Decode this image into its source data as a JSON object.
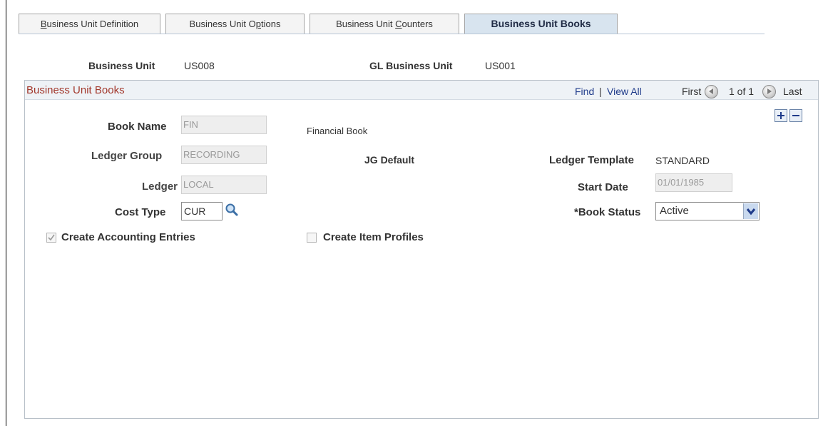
{
  "tabs": [
    {
      "pre": "",
      "acc": "B",
      "post": "usiness Unit Definition"
    },
    {
      "pre": "Business Unit O",
      "acc": "p",
      "post": "tions"
    },
    {
      "pre": "Business Unit ",
      "acc": "C",
      "post": "ounters"
    },
    {
      "pre": "Business Unit Books",
      "acc": "",
      "post": ""
    }
  ],
  "header": {
    "bu_label": "Business Unit",
    "bu_value": "US008",
    "gl_label": "GL Business Unit",
    "gl_value": "US001"
  },
  "box": {
    "title": "Business Unit Books",
    "find": "Find",
    "sep": "|",
    "view_all": "View All",
    "first": "First",
    "count": "1 of 1",
    "last": "Last"
  },
  "form": {
    "book_name_label": "Book Name",
    "book_name_value": "FIN",
    "book_name_desc": "Financial Book",
    "ledger_group_label": "Ledger Group",
    "ledger_group_value": "RECORDING",
    "jg_default": "JG Default",
    "ledger_template_label": "Ledger Template",
    "ledger_template_value": "STANDARD",
    "ledger_label": "Ledger",
    "ledger_value": "LOCAL",
    "start_date_label": "Start Date",
    "start_date_value": "01/01/1985",
    "cost_type_label": "Cost Type",
    "cost_type_value": "CUR",
    "book_status_label": "*Book Status",
    "book_status_value": "Active",
    "create_accounting_label": "Create Accounting Entries",
    "create_accounting_checked": true,
    "create_item_label": "Create Item Profiles",
    "create_item_checked": false
  },
  "icons": {
    "lookup": "magnifier-icon",
    "dropdown": "chevron-down-icon",
    "add": "plus-icon",
    "delete": "minus-icon",
    "prev": "arrow-left-icon",
    "next": "arrow-right-icon",
    "check": "checkmark-icon"
  },
  "colors": {
    "title_accent": "#a2382c",
    "link": "#1f3b8a",
    "active_tab": "#d8e4ef"
  }
}
